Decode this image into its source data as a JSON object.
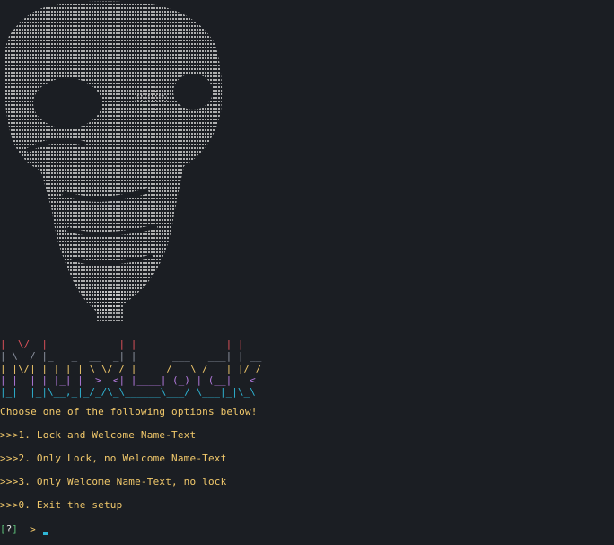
{
  "terminal": {
    "banner_lines": [
      {
        "text": " __  __              _                 _",
        "color": "#e0525a"
      },
      {
        "text": "|  \\/  |            | |               | |",
        "color": "#e0525a"
      },
      {
        "text": "| \\  / |_   _  __  _| |      ___   ___| | __",
        "color": "#8d93a0"
      },
      {
        "text": "| |\\/| | | | | \\ \\/ / |     / _ \\ / __| |/ /",
        "color": "#f2c96b"
      },
      {
        "text": "| |  | | |_| |  >  <| |____| (_) | (__|   <",
        "color": "#b57be0"
      },
      {
        "text": "|_|  |_|\\__,_|_/_/\\_\\______\\___/ \\___|_|\\_\\",
        "color": "#2fb6d6"
      }
    ],
    "menu": {
      "heading": "Choose one of the following options below!",
      "options": [
        ">>>1. Lock and Welcome Name-Text",
        ">>>2. Only Lock, no Welcome Name-Text",
        ">>>3. Only Welcome Name-Text, no lock",
        ">>>0. Exit the setup"
      ]
    },
    "prompt": {
      "open_bracket": "[",
      "symbol": "?",
      "close_bracket": "]",
      "arrow": ">"
    },
    "colors": {
      "background": "#1b1e23",
      "text_yellow": "#f2c96b",
      "ascii_art": "#c8c8c8",
      "cursor": "#2fb6d6"
    }
  }
}
